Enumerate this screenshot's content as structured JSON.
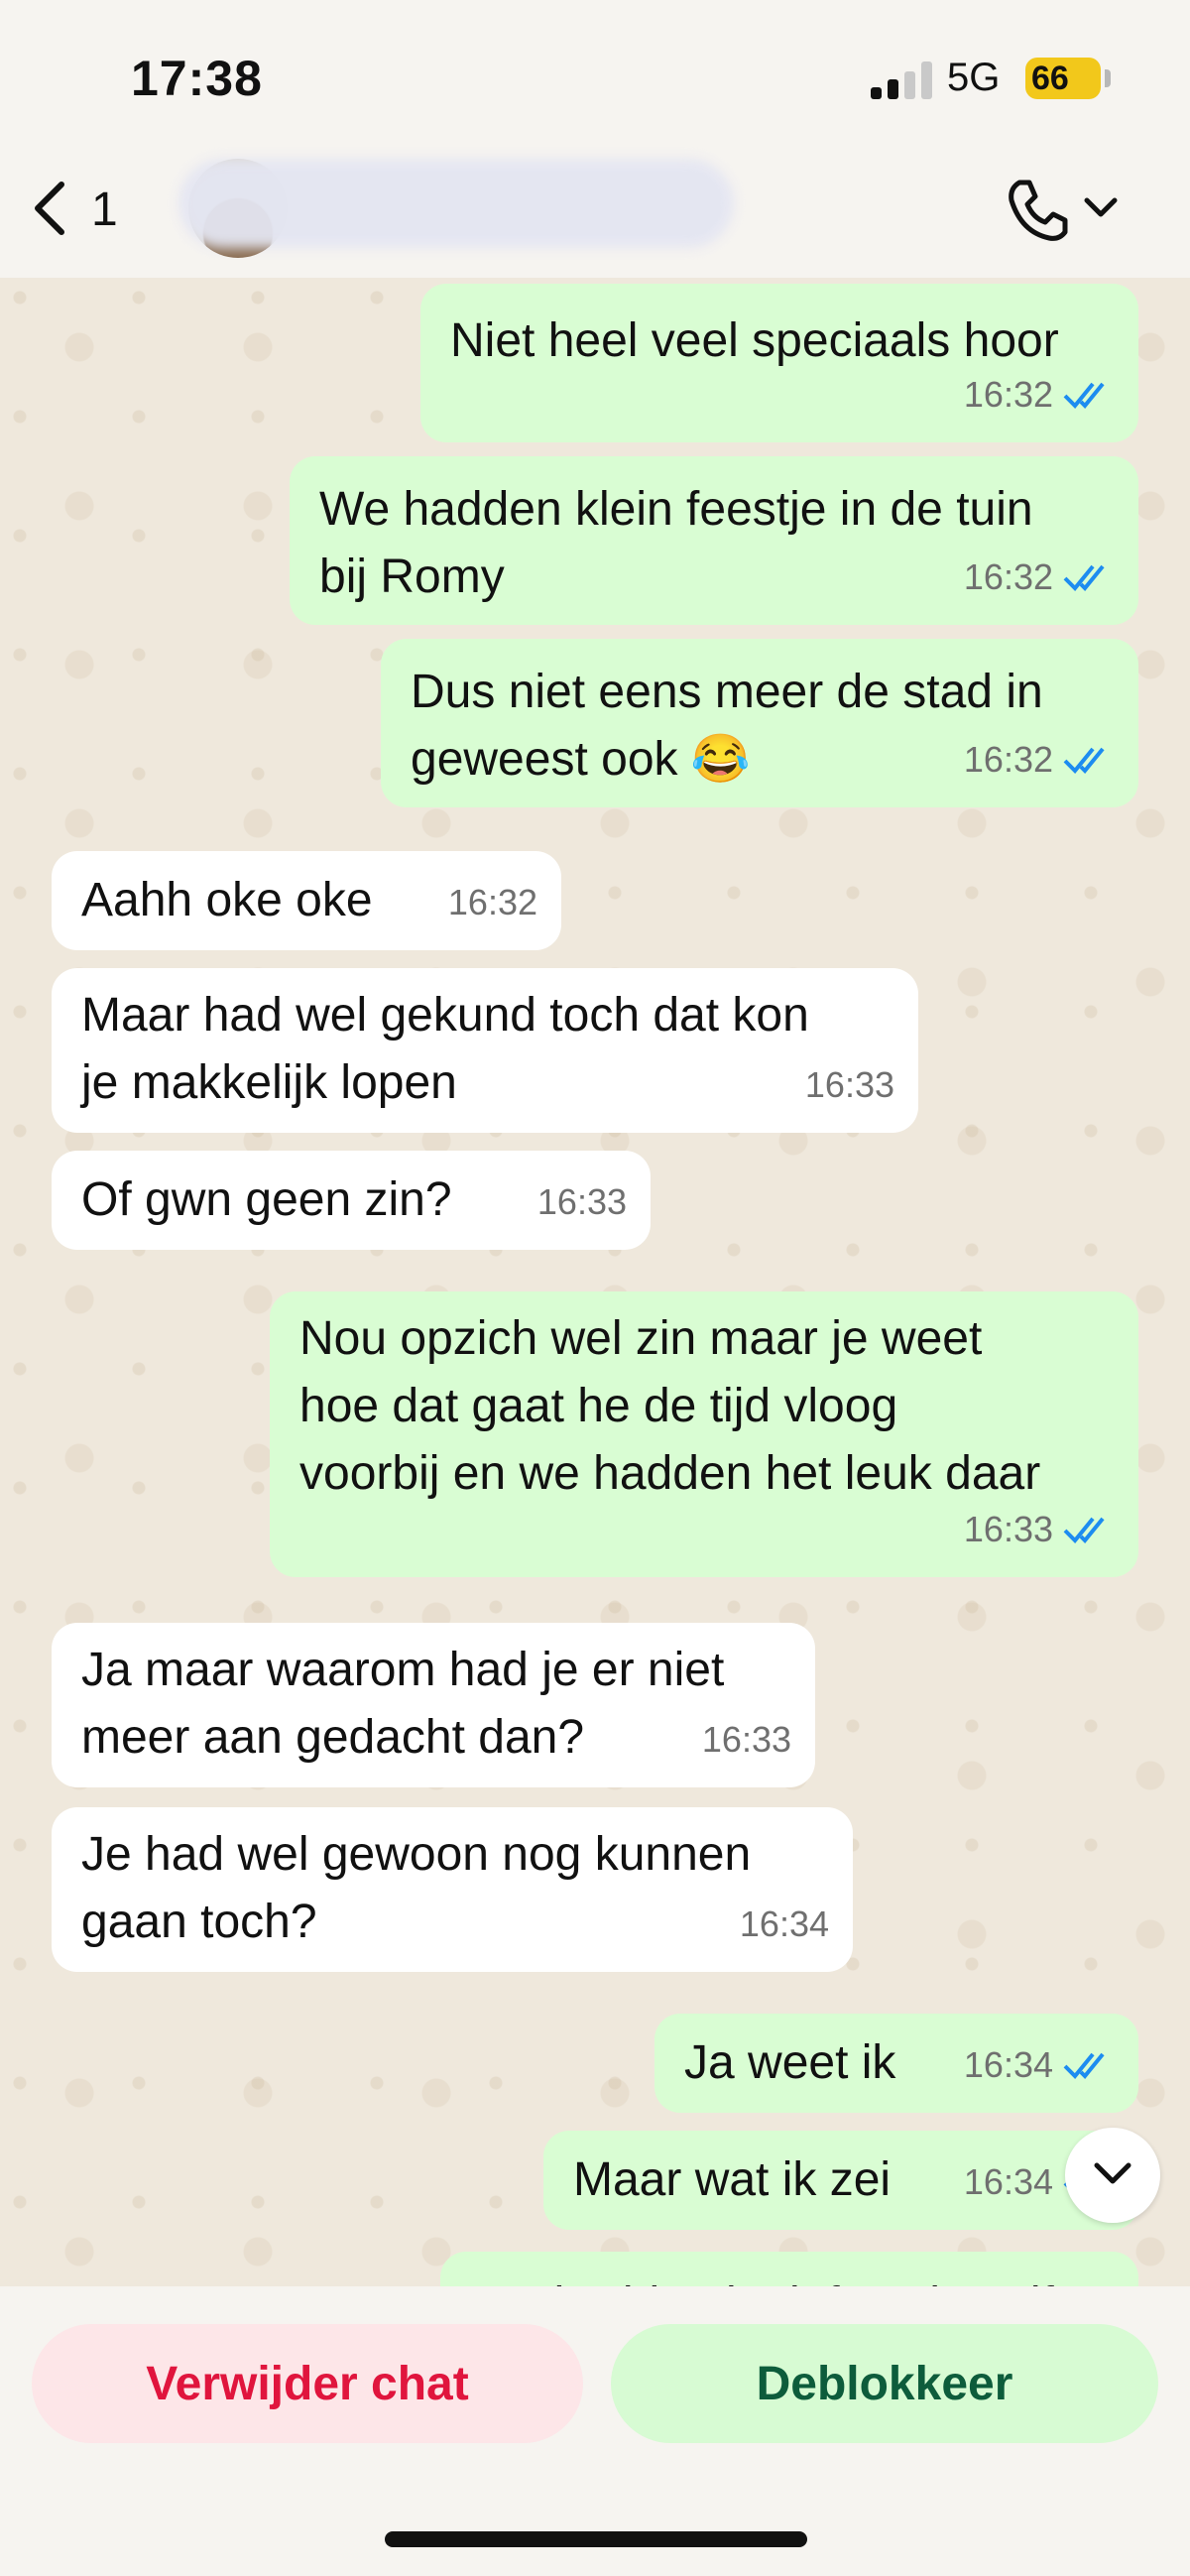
{
  "status_bar": {
    "time": "17:38",
    "network": "5G",
    "battery": "66",
    "battery_icon": "charging-bolt"
  },
  "header": {
    "back_count": "1",
    "contact_name_hidden": true
  },
  "messages": [
    {
      "dir": "out",
      "text": "Niet heel veel speciaals hoor",
      "time": "16:32",
      "read": true
    },
    {
      "dir": "out",
      "text": "We hadden klein feestje in de tuin\nbij Romy",
      "time": "16:32",
      "read": true
    },
    {
      "dir": "out",
      "text": "Dus niet eens meer de stad in\ngeweest ook 😂",
      "time": "16:32",
      "read": true
    },
    {
      "dir": "in",
      "text": "Aahh oke oke",
      "time": "16:32"
    },
    {
      "dir": "in",
      "text": "Maar had wel gekund toch dat kon\nje makkelijk lopen",
      "time": "16:33"
    },
    {
      "dir": "in",
      "text": "Of gwn geen zin?",
      "time": "16:33"
    },
    {
      "dir": "out",
      "text": "Nou opzich wel zin maar je weet\nhoe dat gaat he de tijd vloog\nvoorbij en we hadden het leuk daar",
      "time": "16:33",
      "read": true
    },
    {
      "dir": "in",
      "text": "Ja maar waarom had je er niet\nmeer aan gedacht dan?",
      "time": "16:33"
    },
    {
      "dir": "in",
      "text": "Je had wel gewoon nog kunnen\ngaan toch?",
      "time": "16:34"
    },
    {
      "dir": "out",
      "text": "Ja weet ik",
      "time": "16:34",
      "read": true
    },
    {
      "dir": "out",
      "text": "Maar wat ik zei",
      "time": "16:34",
      "read": true
    },
    {
      "dir": "out",
      "text": "We hadden leuk feestje zelf",
      "time": "",
      "read": false
    }
  ],
  "actions": {
    "delete_label": "Verwijder chat",
    "unblock_label": "Deblokkeer"
  },
  "colors": {
    "outgoing_bubble": "#d9fdd3",
    "incoming_bubble": "#ffffff",
    "read_ticks": "#1d8cf0",
    "delete_text": "#e0153d",
    "unblock_text": "#0d5c3b"
  }
}
